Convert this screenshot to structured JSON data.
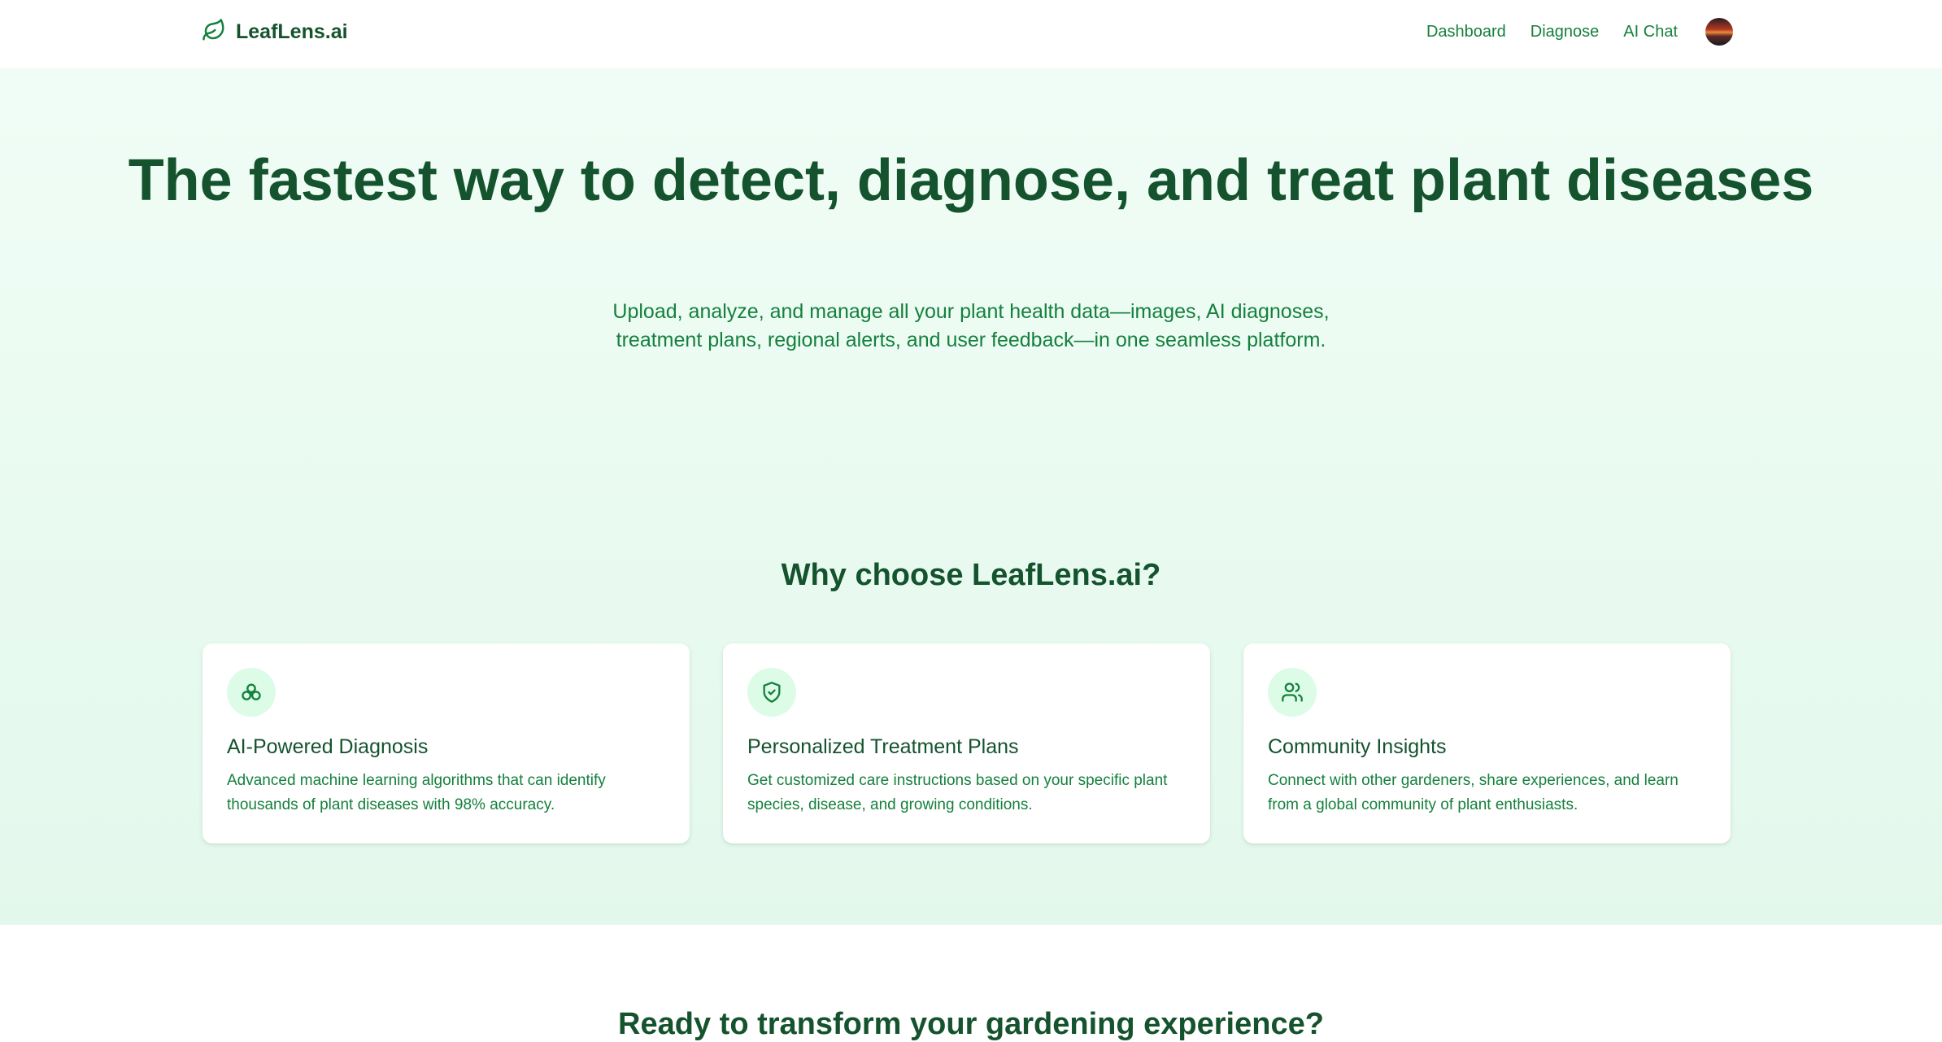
{
  "brand": {
    "name": "LeafLens.ai",
    "icon": "leaf-icon",
    "color": "#15803d"
  },
  "nav": {
    "links": [
      {
        "label": "Dashboard"
      },
      {
        "label": "Diagnose"
      },
      {
        "label": "AI Chat"
      }
    ],
    "avatar": "user-avatar"
  },
  "hero": {
    "title": "The fastest way to detect, diagnose, and treat plant diseases",
    "subtitle": "Upload, analyze, and manage all your plant health data—images, AI diagnoses, treatment plans, regional alerts, and user feedback—in one seamless platform."
  },
  "why": {
    "title": "Why choose LeafLens.ai?",
    "cards": [
      {
        "icon": "ai-cluster-icon",
        "title": "AI-Powered Diagnosis",
        "description": "Advanced machine learning algorithms that can identify thousands of plant diseases with 98% accuracy."
      },
      {
        "icon": "shield-check-icon",
        "title": "Personalized Treatment Plans",
        "description": "Get customized care instructions based on your specific plant species, disease, and growing conditions."
      },
      {
        "icon": "users-icon",
        "title": "Community Insights",
        "description": "Connect with other gardeners, share experiences, and learn from a global community of plant enthusiasts."
      }
    ]
  },
  "cta": {
    "title": "Ready to transform your gardening experience?"
  },
  "colors": {
    "primary_dark": "#14532d",
    "primary": "#15803d",
    "hero_bg": "#f0fdf6",
    "icon_bg": "#dcfce7"
  }
}
